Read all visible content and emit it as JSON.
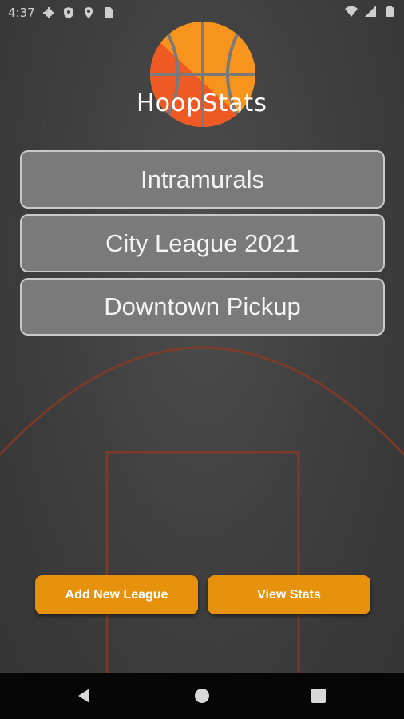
{
  "status_bar": {
    "time": "4:37",
    "icons_left": [
      "gear-icon",
      "shield-icon",
      "location-icon",
      "sim-card-icon"
    ],
    "icons_right": [
      "wifi-icon",
      "cell-signal-icon",
      "battery-icon"
    ]
  },
  "app": {
    "title": "HoopStats",
    "logo": "basketball-logo"
  },
  "leagues": [
    {
      "label": "Intramurals"
    },
    {
      "label": "City League 2021"
    },
    {
      "label": "Downtown Pickup"
    }
  ],
  "actions": {
    "add_label": "Add New League",
    "stats_label": "View Stats"
  },
  "nav": {
    "icons": [
      "back-icon",
      "home-icon",
      "recents-icon"
    ]
  },
  "colors": {
    "background": "#3a3a3a",
    "accent": "#e6920d",
    "court_line": "#9a3a22",
    "league_button": "#7a7a7a"
  }
}
